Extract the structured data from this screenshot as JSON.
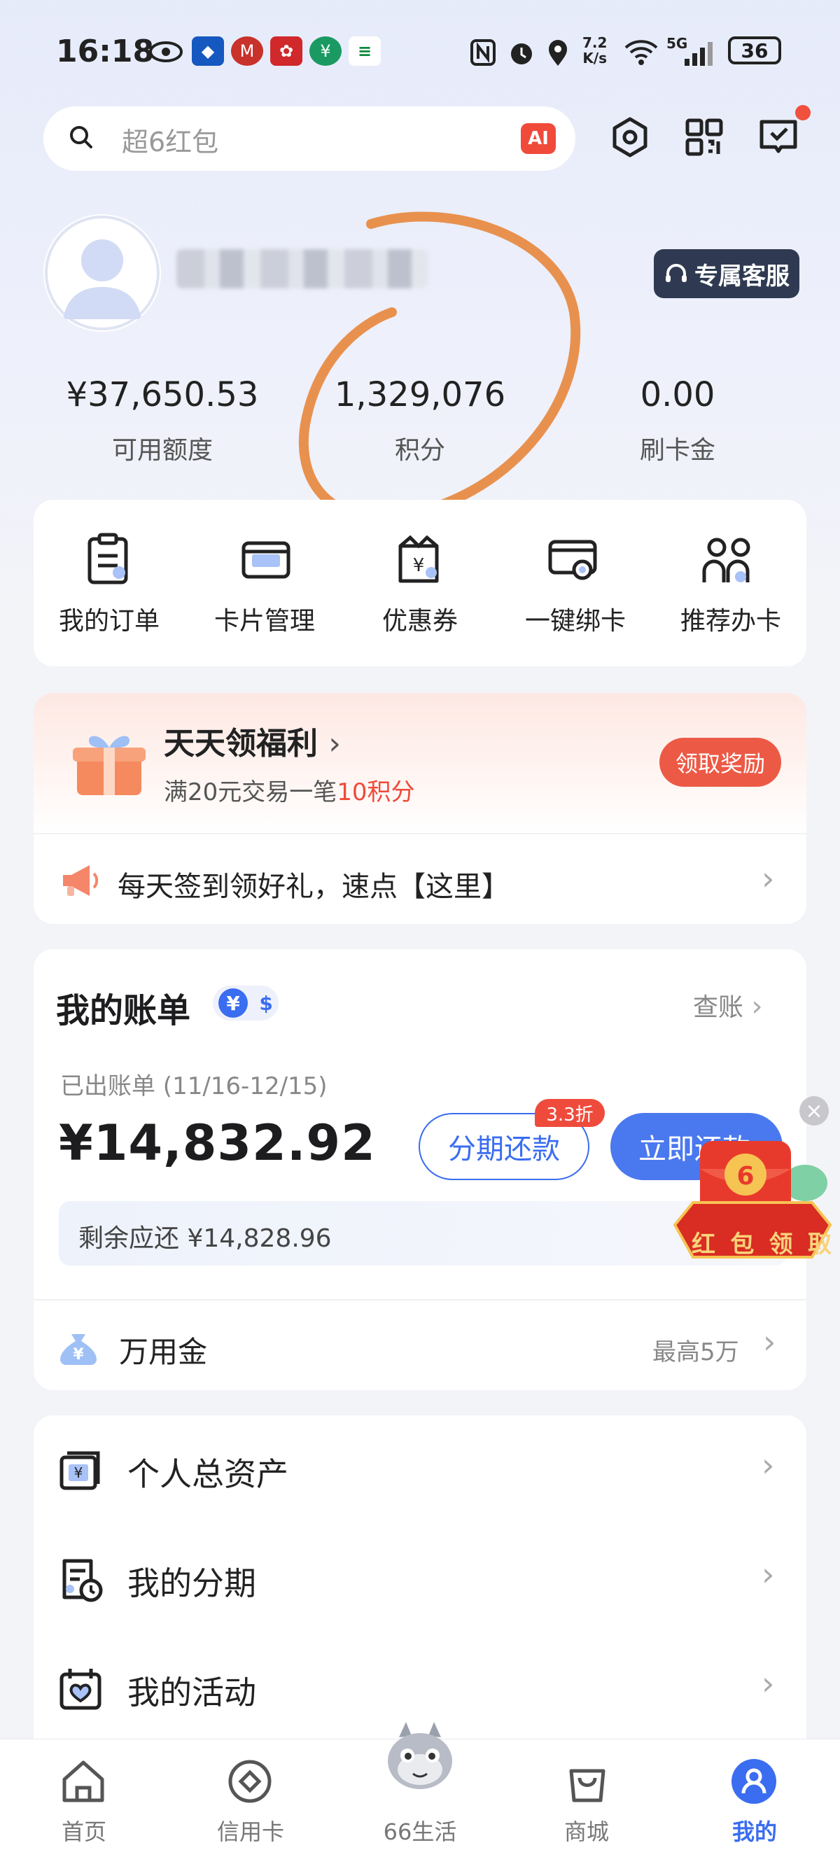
{
  "status_bar": {
    "time": "16:18",
    "network_speed": "7.2 K/s",
    "signal": "5G",
    "battery": "36"
  },
  "search": {
    "placeholder": "超6红包",
    "ai_badge": "AI"
  },
  "profile": {
    "service_label": "专属客服"
  },
  "stats": [
    {
      "value": "¥37,650.53",
      "label": "可用额度"
    },
    {
      "value": "1,329,076",
      "label": "积分"
    },
    {
      "value": "0.00",
      "label": "刷卡金"
    }
  ],
  "quick_actions": [
    {
      "label": "我的订单",
      "icon": "order-icon"
    },
    {
      "label": "卡片管理",
      "icon": "card-icon"
    },
    {
      "label": "优惠券",
      "icon": "coupon-icon"
    },
    {
      "label": "一键绑卡",
      "icon": "bind-card-icon"
    },
    {
      "label": "推荐办卡",
      "icon": "refer-icon"
    }
  ],
  "welfare": {
    "title": "天天领福利",
    "sub_prefix": "满20元交易一笔",
    "sub_highlight": "10积分",
    "button": "领取奖励",
    "checkin": "每天签到领好礼，速点【这里】"
  },
  "bill": {
    "title": "我的账单",
    "currency_cny": "¥",
    "currency_usd": "$",
    "check_link": "查账",
    "statement_label": "已出账单 (11/16-12/15)",
    "amount": "¥14,832.92",
    "installment_button": "分期还款",
    "discount_badge": "3.3折",
    "pay_button": "立即还款",
    "remaining": "剩余应还 ¥14,828.96"
  },
  "red_packet": {
    "text": [
      "红",
      "包",
      "领",
      "取"
    ]
  },
  "wanyongjin": {
    "label": "万用金",
    "right": "最高5万"
  },
  "menu": [
    {
      "label": "个人总资产",
      "icon": "assets-icon"
    },
    {
      "label": "我的分期",
      "icon": "installment-icon"
    },
    {
      "label": "我的活动",
      "icon": "activity-icon"
    }
  ],
  "tabs": [
    {
      "label": "首页",
      "icon": "home-icon"
    },
    {
      "label": "信用卡",
      "icon": "credit-card-icon"
    },
    {
      "label": "66生活",
      "icon": "mascot-icon"
    },
    {
      "label": "商城",
      "icon": "shop-icon"
    },
    {
      "label": "我的",
      "icon": "profile-icon",
      "active": true
    }
  ],
  "colors": {
    "accent": "#3a6df0",
    "red": "#f04a3a",
    "annotation": "#e8914e"
  }
}
